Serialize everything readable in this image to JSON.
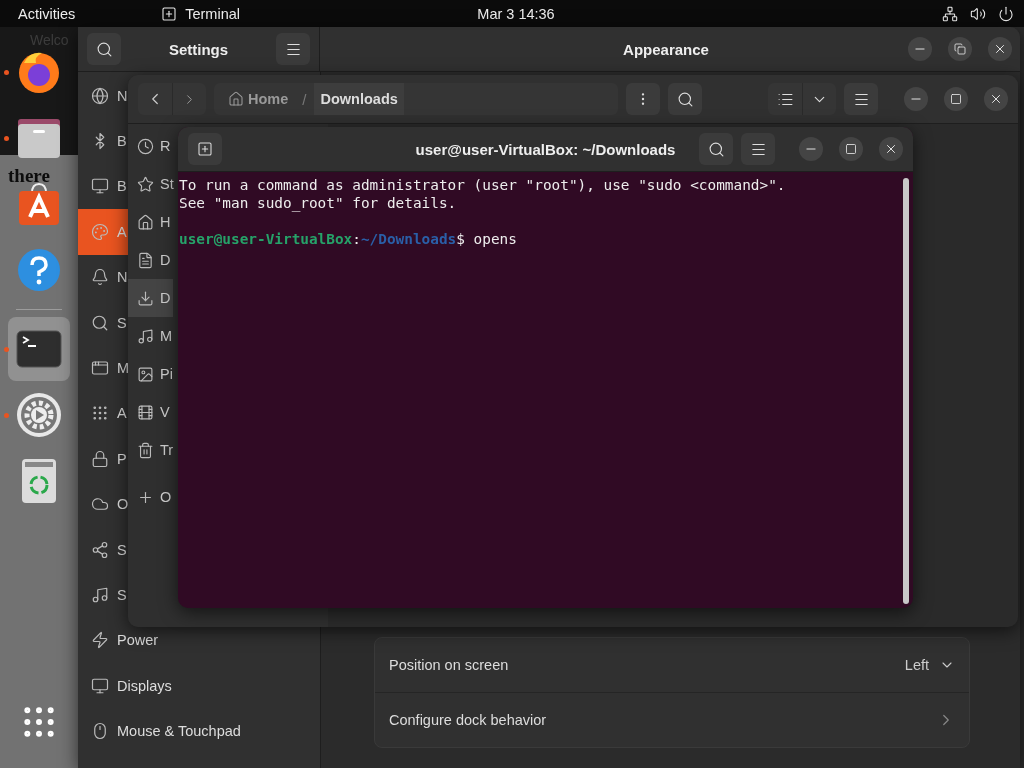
{
  "top_bar": {
    "activities": "Activities",
    "app_name": "Terminal",
    "clock": "Mar 3 14:36"
  },
  "background_window": {
    "tab_title": "Welco",
    "lines": [
      "there"
    ]
  },
  "dock": {
    "groups": [
      {
        "items": [
          {
            "kind": "browser",
            "running": true,
            "selected": false
          },
          {
            "kind": "files",
            "running": true,
            "selected": false
          },
          {
            "kind": "store",
            "running": false,
            "selected": false
          },
          {
            "kind": "help",
            "running": false,
            "selected": false
          }
        ]
      },
      {
        "items": [
          {
            "kind": "terminal",
            "running": true,
            "selected": true
          },
          {
            "kind": "settings",
            "running": true,
            "selected": false
          },
          {
            "kind": "trash",
            "running": false,
            "selected": false
          }
        ]
      }
    ]
  },
  "settings": {
    "title": "Settings",
    "page_title": "Appearance",
    "sidebar": [
      {
        "label": "N",
        "selected": false
      },
      {
        "label": "B",
        "selected": false
      },
      {
        "label": "B",
        "selected": false
      },
      {
        "label": "A",
        "selected": true
      },
      {
        "label": "N",
        "selected": false
      },
      {
        "label": "S",
        "selected": false
      },
      {
        "label": "M",
        "selected": false
      },
      {
        "label": "A",
        "selected": false
      },
      {
        "label": "P",
        "selected": false
      },
      {
        "label": "O",
        "selected": false
      },
      {
        "label": "S",
        "selected": false
      },
      {
        "label": "S",
        "selected": false
      },
      {
        "label": "Power",
        "selected": false
      },
      {
        "label": "Displays",
        "selected": false
      },
      {
        "label": "Mouse & Touchpad",
        "selected": false
      }
    ],
    "rows": [
      {
        "kind": "dropdown",
        "label": "Position on screen",
        "value": "Left"
      },
      {
        "kind": "link",
        "label": "Configure dock behavior"
      }
    ]
  },
  "files": {
    "path_separator": "/",
    "path": [
      {
        "label": "Home",
        "selected": false
      },
      {
        "label": "Downloads",
        "selected": true
      }
    ],
    "sidebar": [
      {
        "label": "R",
        "selected": false
      },
      {
        "label": "St",
        "selected": false
      },
      {
        "label": "H",
        "selected": false
      },
      {
        "label": "D",
        "selected": false
      },
      {
        "label": "D",
        "selected": true
      },
      {
        "label": "M",
        "selected": false
      },
      {
        "label": "Pi",
        "selected": false
      },
      {
        "label": "V",
        "selected": false
      },
      {
        "label": "Tr",
        "selected": false
      },
      {
        "label": "O",
        "selected": false
      }
    ]
  },
  "terminal": {
    "title": "user@user-VirtualBox: ~/Downloads",
    "lines": [
      {
        "kind": "output",
        "text": "To run a command as administrator (user \"root\"), use \"sudo <command>\"."
      },
      {
        "kind": "output",
        "text": "See \"man sudo_root\" for details."
      },
      {
        "kind": "blank"
      },
      {
        "kind": "prompt",
        "user": "user@user-VirtualBox",
        "separator": ":",
        "path": "~/Downloads",
        "symbol": "$",
        "command": "opens"
      }
    ]
  }
}
